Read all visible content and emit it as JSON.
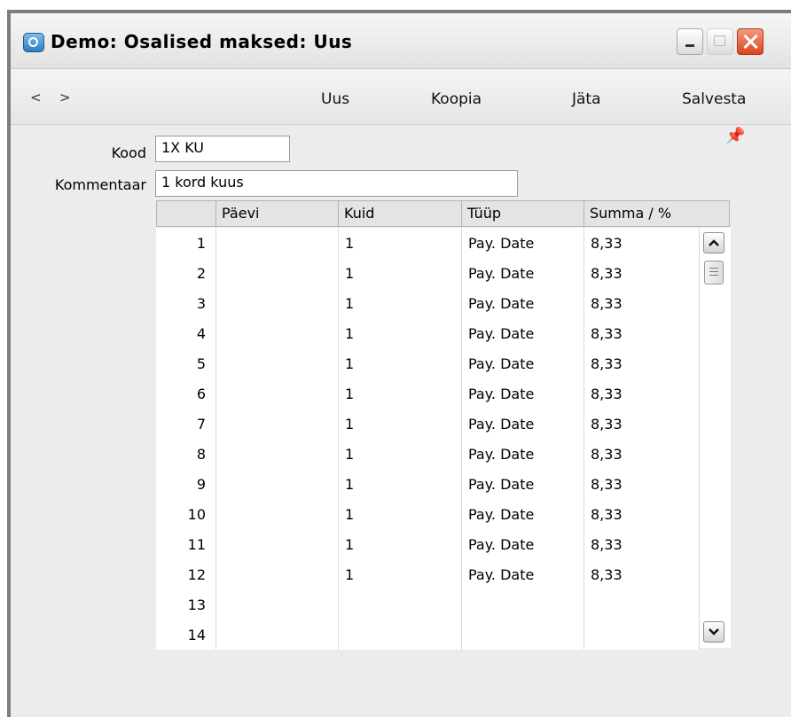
{
  "window": {
    "title": "Demo: Osalised maksed: Uus"
  },
  "toolbar": {
    "prev": "<",
    "next": ">",
    "new_label": "Uus",
    "copy_label": "Koopia",
    "cancel_label": "Jäta",
    "save_label": "Salvesta"
  },
  "form": {
    "code_label": "Kood",
    "code_value": "1X KU",
    "comment_label": "Kommentaar",
    "comment_value": "1 kord kuus"
  },
  "table": {
    "columns": [
      "",
      "Päevi",
      "Kuid",
      "Tüüp",
      "Summa / %"
    ],
    "rows": [
      [
        "1",
        "",
        "1",
        "Pay. Date",
        "8,33"
      ],
      [
        "2",
        "",
        "1",
        "Pay. Date",
        "8,33"
      ],
      [
        "3",
        "",
        "1",
        "Pay. Date",
        "8,33"
      ],
      [
        "4",
        "",
        "1",
        "Pay. Date",
        "8,33"
      ],
      [
        "5",
        "",
        "1",
        "Pay. Date",
        "8,33"
      ],
      [
        "6",
        "",
        "1",
        "Pay. Date",
        "8,33"
      ],
      [
        "7",
        "",
        "1",
        "Pay. Date",
        "8,33"
      ],
      [
        "8",
        "",
        "1",
        "Pay. Date",
        "8,33"
      ],
      [
        "9",
        "",
        "1",
        "Pay. Date",
        "8,33"
      ],
      [
        "10",
        "",
        "1",
        "Pay. Date",
        "8,33"
      ],
      [
        "11",
        "",
        "1",
        "Pay. Date",
        "8,33"
      ],
      [
        "12",
        "",
        "1",
        "Pay. Date",
        "8,33"
      ],
      [
        "13",
        "",
        "",
        "",
        ""
      ],
      [
        "14",
        "",
        "",
        "",
        ""
      ]
    ]
  },
  "icons": {
    "app": "app-icon",
    "pin": "pin-icon",
    "scroll_up": "chevron-up-icon",
    "scroll_down": "chevron-down-icon"
  }
}
